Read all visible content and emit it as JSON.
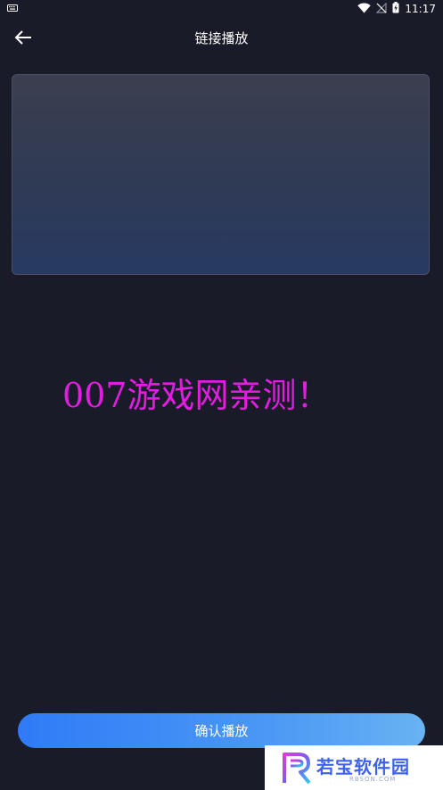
{
  "status_bar": {
    "time": "11:17",
    "icons": [
      "keyboard-icon",
      "wifi-icon",
      "signal-off-icon",
      "battery-charging-icon"
    ]
  },
  "header": {
    "title": "链接播放",
    "back_icon": "arrow-left-icon"
  },
  "link_input": {
    "value": "",
    "placeholder": ""
  },
  "overlay": {
    "text": "007游戏网亲测！"
  },
  "footer": {
    "confirm_label": "确认播放"
  },
  "watermark_logo": {
    "name": "若宝软件园",
    "sub": "RBSON.COM"
  },
  "colors": {
    "background": "#191b28",
    "accent": "#2f7bf7",
    "overlay_text": "#e21ce0",
    "logo": "#3e62ee"
  }
}
